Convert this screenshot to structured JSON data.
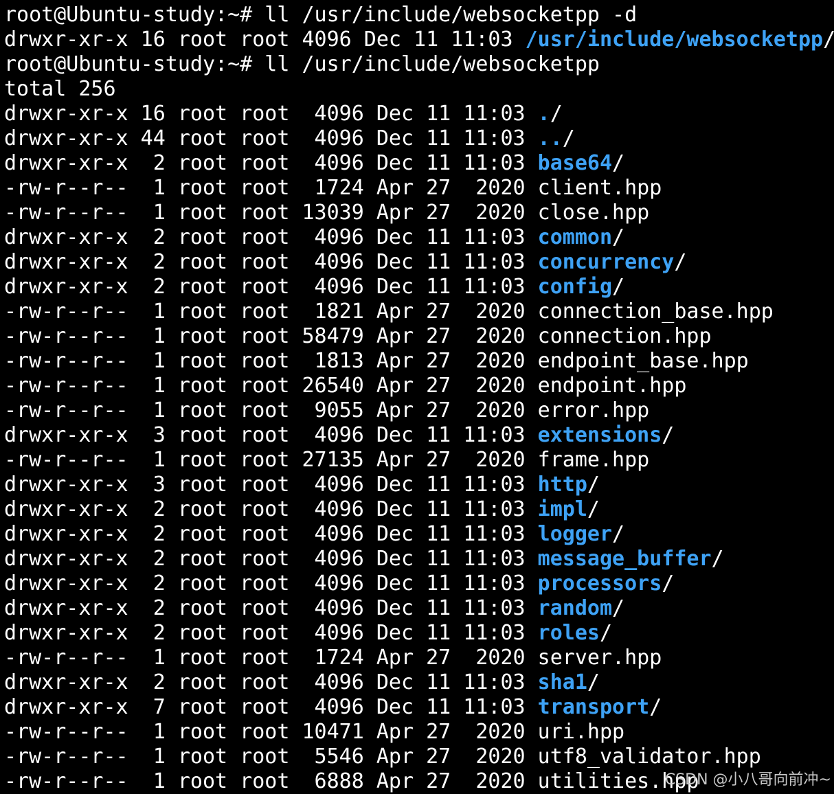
{
  "colors": {
    "background": "#000000",
    "text": "#ffffff",
    "directory": "#3ea2f5"
  },
  "terminal": {
    "lines": [
      {
        "type": "command",
        "prompt": "root@Ubuntu-study:~# ",
        "command": "ll /usr/include/websocketpp -d"
      },
      {
        "type": "output",
        "prefix": "drwxr-xr-x 16 root root 4096 Dec 11 11:03 ",
        "name": "/usr/include/websocketpp",
        "suffix": "/",
        "is_dir": true
      },
      {
        "type": "command",
        "prompt": "root@Ubuntu-study:~# ",
        "command": "ll /usr/include/websocketpp"
      },
      {
        "type": "output",
        "prefix": "total 256",
        "name": "",
        "suffix": "",
        "is_dir": false
      },
      {
        "type": "output",
        "prefix": "drwxr-xr-x 16 root root  4096 Dec 11 11:03 ",
        "name": ".",
        "suffix": "/",
        "is_dir": true
      },
      {
        "type": "output",
        "prefix": "drwxr-xr-x 44 root root  4096 Dec 11 11:03 ",
        "name": "..",
        "suffix": "/",
        "is_dir": true
      },
      {
        "type": "output",
        "prefix": "drwxr-xr-x  2 root root  4096 Dec 11 11:03 ",
        "name": "base64",
        "suffix": "/",
        "is_dir": true
      },
      {
        "type": "output",
        "prefix": "-rw-r--r--  1 root root  1724 Apr 27  2020 ",
        "name": "client.hpp",
        "suffix": "",
        "is_dir": false
      },
      {
        "type": "output",
        "prefix": "-rw-r--r--  1 root root 13039 Apr 27  2020 ",
        "name": "close.hpp",
        "suffix": "",
        "is_dir": false
      },
      {
        "type": "output",
        "prefix": "drwxr-xr-x  2 root root  4096 Dec 11 11:03 ",
        "name": "common",
        "suffix": "/",
        "is_dir": true
      },
      {
        "type": "output",
        "prefix": "drwxr-xr-x  2 root root  4096 Dec 11 11:03 ",
        "name": "concurrency",
        "suffix": "/",
        "is_dir": true
      },
      {
        "type": "output",
        "prefix": "drwxr-xr-x  2 root root  4096 Dec 11 11:03 ",
        "name": "config",
        "suffix": "/",
        "is_dir": true
      },
      {
        "type": "output",
        "prefix": "-rw-r--r--  1 root root  1821 Apr 27  2020 ",
        "name": "connection_base.hpp",
        "suffix": "",
        "is_dir": false
      },
      {
        "type": "output",
        "prefix": "-rw-r--r--  1 root root 58479 Apr 27  2020 ",
        "name": "connection.hpp",
        "suffix": "",
        "is_dir": false
      },
      {
        "type": "output",
        "prefix": "-rw-r--r--  1 root root  1813 Apr 27  2020 ",
        "name": "endpoint_base.hpp",
        "suffix": "",
        "is_dir": false
      },
      {
        "type": "output",
        "prefix": "-rw-r--r--  1 root root 26540 Apr 27  2020 ",
        "name": "endpoint.hpp",
        "suffix": "",
        "is_dir": false
      },
      {
        "type": "output",
        "prefix": "-rw-r--r--  1 root root  9055 Apr 27  2020 ",
        "name": "error.hpp",
        "suffix": "",
        "is_dir": false
      },
      {
        "type": "output",
        "prefix": "drwxr-xr-x  3 root root  4096 Dec 11 11:03 ",
        "name": "extensions",
        "suffix": "/",
        "is_dir": true
      },
      {
        "type": "output",
        "prefix": "-rw-r--r--  1 root root 27135 Apr 27  2020 ",
        "name": "frame.hpp",
        "suffix": "",
        "is_dir": false
      },
      {
        "type": "output",
        "prefix": "drwxr-xr-x  3 root root  4096 Dec 11 11:03 ",
        "name": "http",
        "suffix": "/",
        "is_dir": true
      },
      {
        "type": "output",
        "prefix": "drwxr-xr-x  2 root root  4096 Dec 11 11:03 ",
        "name": "impl",
        "suffix": "/",
        "is_dir": true
      },
      {
        "type": "output",
        "prefix": "drwxr-xr-x  2 root root  4096 Dec 11 11:03 ",
        "name": "logger",
        "suffix": "/",
        "is_dir": true
      },
      {
        "type": "output",
        "prefix": "drwxr-xr-x  2 root root  4096 Dec 11 11:03 ",
        "name": "message_buffer",
        "suffix": "/",
        "is_dir": true
      },
      {
        "type": "output",
        "prefix": "drwxr-xr-x  2 root root  4096 Dec 11 11:03 ",
        "name": "processors",
        "suffix": "/",
        "is_dir": true
      },
      {
        "type": "output",
        "prefix": "drwxr-xr-x  2 root root  4096 Dec 11 11:03 ",
        "name": "random",
        "suffix": "/",
        "is_dir": true
      },
      {
        "type": "output",
        "prefix": "drwxr-xr-x  2 root root  4096 Dec 11 11:03 ",
        "name": "roles",
        "suffix": "/",
        "is_dir": true
      },
      {
        "type": "output",
        "prefix": "-rw-r--r--  1 root root  1724 Apr 27  2020 ",
        "name": "server.hpp",
        "suffix": "",
        "is_dir": false
      },
      {
        "type": "output",
        "prefix": "drwxr-xr-x  2 root root  4096 Dec 11 11:03 ",
        "name": "sha1",
        "suffix": "/",
        "is_dir": true
      },
      {
        "type": "output",
        "prefix": "drwxr-xr-x  7 root root  4096 Dec 11 11:03 ",
        "name": "transport",
        "suffix": "/",
        "is_dir": true
      },
      {
        "type": "output",
        "prefix": "-rw-r--r--  1 root root 10471 Apr 27  2020 ",
        "name": "uri.hpp",
        "suffix": "",
        "is_dir": false
      },
      {
        "type": "output",
        "prefix": "-rw-r--r--  1 root root  5546 Apr 27  2020 ",
        "name": "utf8_validator.hpp",
        "suffix": "",
        "is_dir": false
      },
      {
        "type": "output",
        "prefix": "-rw-r--r--  1 root root  6888 Apr 27  2020 ",
        "name": "utilities.hpp",
        "suffix": "",
        "is_dir": false
      }
    ]
  },
  "watermark": "CSDN @小八哥向前冲~"
}
